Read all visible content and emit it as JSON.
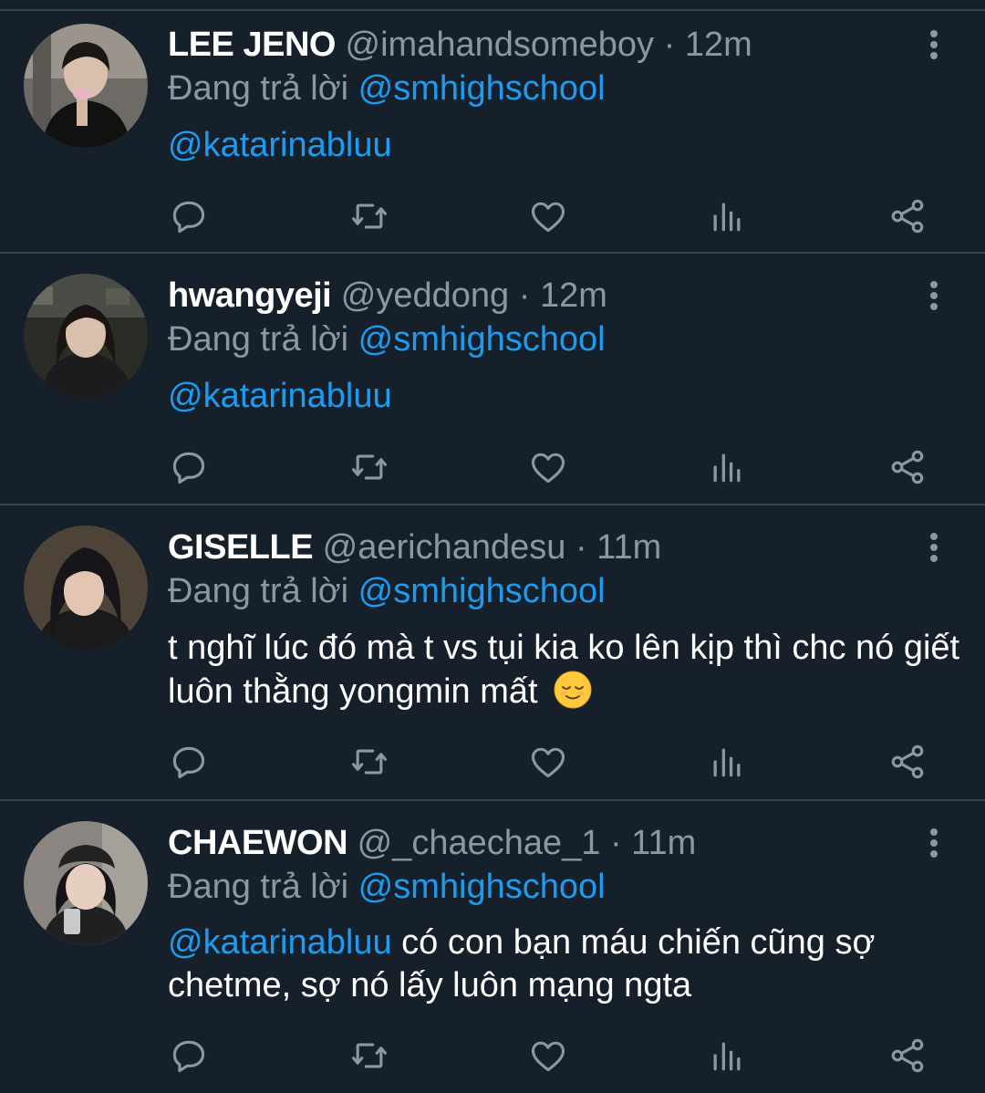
{
  "reply_prefix": "Đang trả lời",
  "tweets": [
    {
      "name": "LEE JENO",
      "handle": "@imahandsomeboy",
      "separator": "·",
      "time": "12m",
      "replying_to": "@smhighschool",
      "mention": "@katarinabluu",
      "text": "",
      "emoji": ""
    },
    {
      "name": "hwangyeji",
      "handle": "@yeddong",
      "separator": "·",
      "time": "12m",
      "replying_to": "@smhighschool",
      "mention": "@katarinabluu",
      "text": "",
      "emoji": ""
    },
    {
      "name": "GISELLE",
      "handle": "@aerichandesu",
      "separator": "·",
      "time": "11m",
      "replying_to": "@smhighschool",
      "mention": "",
      "text": "t nghĩ lúc đó mà t vs tụi kia ko lên kịp thì chc nó giết luôn thằng yongmin mất",
      "emoji": "relieved-face"
    },
    {
      "name": "CHAEWON",
      "handle": "@_chaechae_1",
      "separator": "·",
      "time": "11m",
      "replying_to": "@smhighschool",
      "mention": "@katarinabluu",
      "text": "có con bạn máu chiến cũng sợ chetme, sợ nó lấy luôn mạng ngta",
      "emoji": ""
    }
  ],
  "icons": {
    "reply": "reply-icon",
    "retweet": "retweet-icon",
    "like": "like-icon",
    "analytics": "analytics-icon",
    "share": "share-icon",
    "more": "more-vertical-icon"
  },
  "colors": {
    "background": "#15202b",
    "divider": "#38444d",
    "secondary_text": "#8899a6",
    "link": "#1d9bf0",
    "action_icon": "#8899a6"
  }
}
